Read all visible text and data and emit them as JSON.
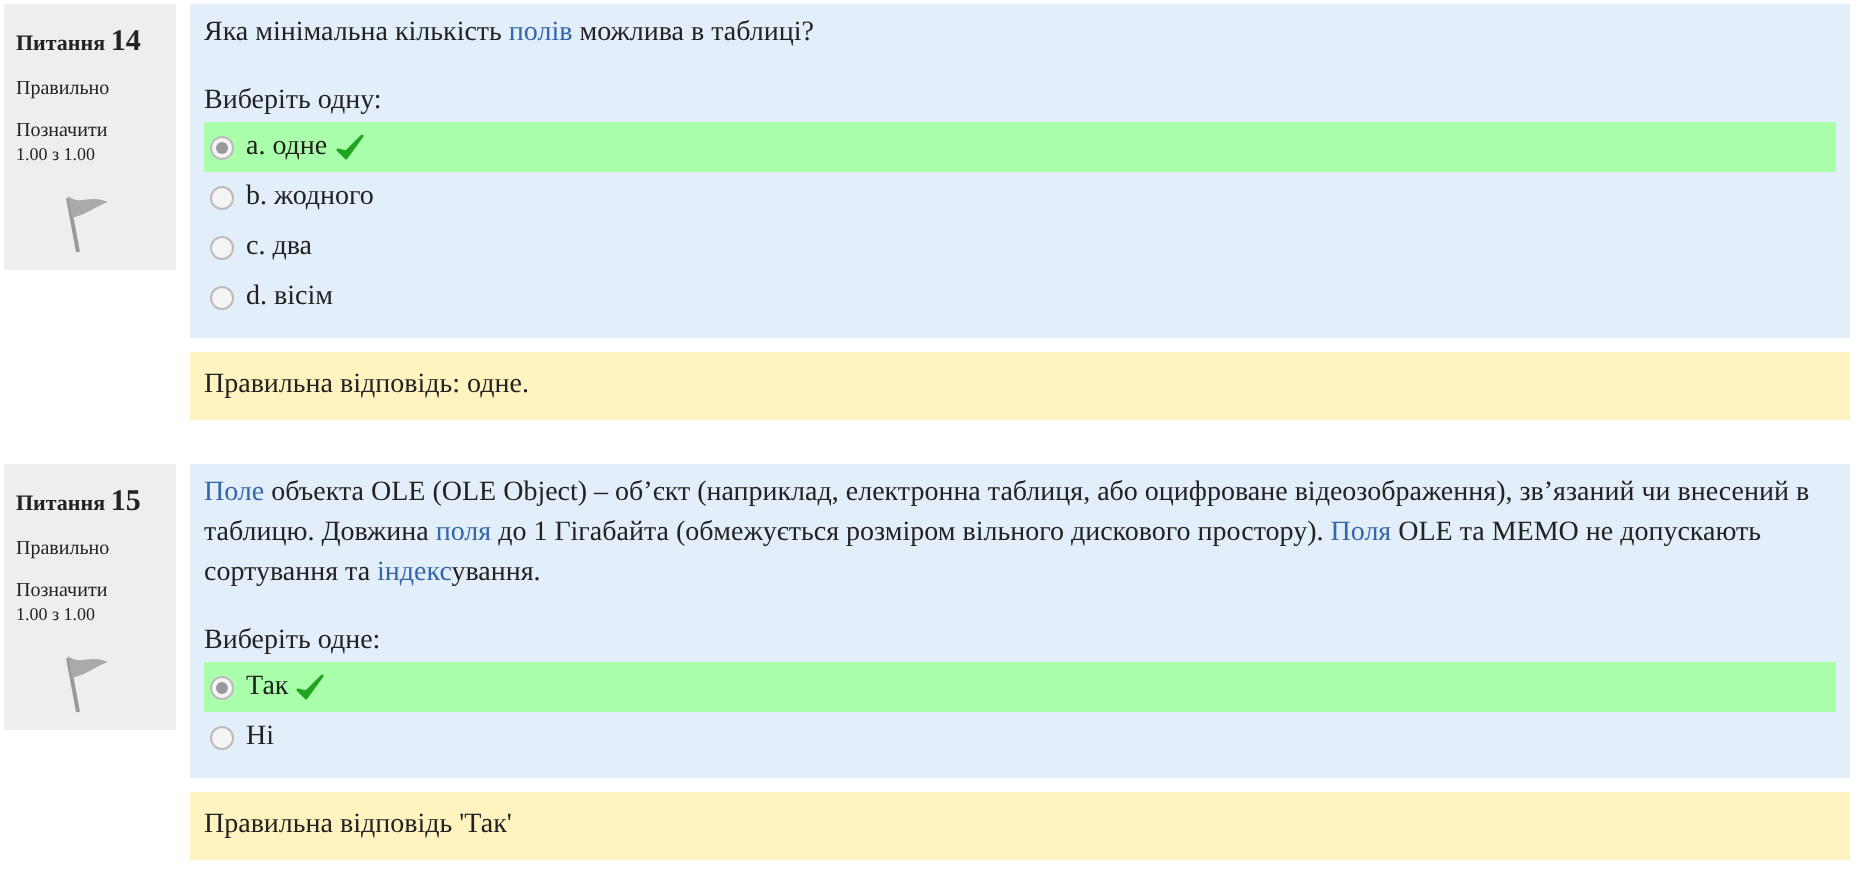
{
  "questions": [
    {
      "label": "Питання",
      "number": "14",
      "status": "Правильно",
      "flag_label": "Позначити",
      "grade": "1.00 з 1.00",
      "flagged": false,
      "text": [
        {
          "text": "Яка мінімальна кількість ",
          "link": false
        },
        {
          "text": "полів",
          "link": true
        },
        {
          "text": " можлива в таблиці?",
          "link": false
        }
      ],
      "prompt": "Виберіть одну:",
      "options": [
        {
          "label": "a. одне",
          "selected": true,
          "correct": true
        },
        {
          "label": "b. жодного",
          "selected": false,
          "correct": false
        },
        {
          "label": "c. два",
          "selected": false,
          "correct": false
        },
        {
          "label": "d. вісім",
          "selected": false,
          "correct": false
        }
      ],
      "feedback": "Правильна відповідь: одне."
    },
    {
      "label": "Питання",
      "number": "15",
      "status": "Правильно",
      "flag_label": "Позначити",
      "grade": "1.00 з 1.00",
      "flagged": false,
      "text": [
        {
          "text": "Поле",
          "link": true
        },
        {
          "text": " объекта OLE (OLE Object) – об’єкт (наприклад, електронна таблиця, або оцифроване відеозображення), зв’язаний чи внесений в таблицю. Довжина ",
          "link": false
        },
        {
          "text": "поля",
          "link": true
        },
        {
          "text": " до 1 Гігабайта (обмежується розміром вільного дискового простору). ",
          "link": false
        },
        {
          "text": "Поля",
          "link": true
        },
        {
          "text": " OLE та MEMO не допускають сортування та ",
          "link": false
        },
        {
          "text": "індекс",
          "link": true
        },
        {
          "text": "ування.",
          "link": false
        }
      ],
      "prompt": "Виберіть одне:",
      "options": [
        {
          "label": "Так",
          "selected": true,
          "correct": true
        },
        {
          "label": "Ні",
          "selected": false,
          "correct": false
        }
      ],
      "feedback": "Правильна відповідь 'Так'"
    }
  ]
}
